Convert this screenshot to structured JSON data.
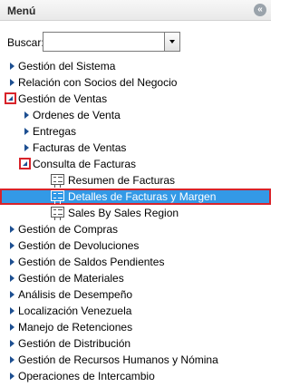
{
  "header": {
    "title": "Menú"
  },
  "search": {
    "label": "Buscar:",
    "value": "",
    "placeholder": ""
  },
  "tree": {
    "items": [
      {
        "label": "Gestión del Sistema",
        "level": 0,
        "state": "collapsed"
      },
      {
        "label": "Relación con Socios del Negocio",
        "level": 0,
        "state": "collapsed"
      },
      {
        "label": "Gestión de Ventas",
        "level": 0,
        "state": "expanded"
      },
      {
        "label": "Ordenes de Venta",
        "level": 1,
        "state": "collapsed"
      },
      {
        "label": "Entregas",
        "level": 1,
        "state": "collapsed"
      },
      {
        "label": "Facturas de Ventas",
        "level": 1,
        "state": "collapsed"
      },
      {
        "label": "Consulta de Facturas",
        "level": 1,
        "state": "expanded"
      },
      {
        "label": "Resumen de Facturas",
        "level": 2,
        "state": "leaf"
      },
      {
        "label": "Detalles de Facturas y Margen",
        "level": 2,
        "state": "leaf",
        "selected": true
      },
      {
        "label": "Sales By Sales Region",
        "level": 2,
        "state": "leaf"
      },
      {
        "label": "Gestión de Compras",
        "level": 0,
        "state": "collapsed"
      },
      {
        "label": "Gestión de Devoluciones",
        "level": 0,
        "state": "collapsed"
      },
      {
        "label": "Gestión de Saldos Pendientes",
        "level": 0,
        "state": "collapsed"
      },
      {
        "label": "Gestión de Materiales",
        "level": 0,
        "state": "collapsed"
      },
      {
        "label": "Análisis de Desempeño",
        "level": 0,
        "state": "collapsed"
      },
      {
        "label": "Localización Venezuela",
        "level": 0,
        "state": "collapsed"
      },
      {
        "label": "Manejo de Retenciones",
        "level": 0,
        "state": "collapsed"
      },
      {
        "label": "Gestión de Distribución",
        "level": 0,
        "state": "collapsed"
      },
      {
        "label": "Gestión de Recursos Humanos y Nómina",
        "level": 0,
        "state": "collapsed"
      },
      {
        "label": "Operaciones de Intercambio",
        "level": 0,
        "state": "collapsed"
      }
    ]
  },
  "colors": {
    "selected_bg": "#3399e6",
    "highlight_border": "#d8232a",
    "arrow": "#1d4f91"
  },
  "icons": {
    "collapse": "double-chevron-left-icon",
    "leaf": "report-icon"
  }
}
